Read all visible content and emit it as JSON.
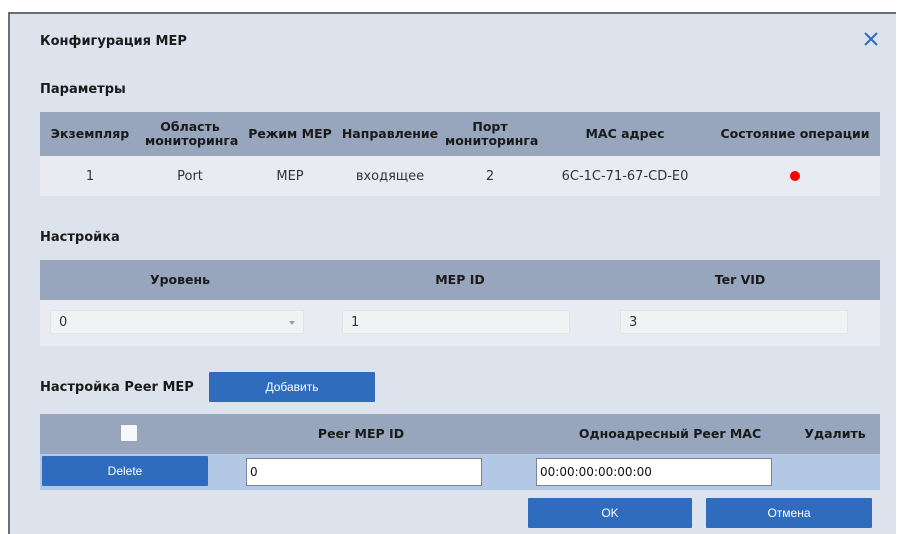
{
  "dialog": {
    "title": "Конфигурация MEP"
  },
  "parameters": {
    "label": "Параметры",
    "columns": [
      "Экземпляр",
      "Область мониторинга",
      "Режим MEP",
      "Направление",
      "Порт мониторинга",
      "MAC адрес",
      "Состояние операции"
    ],
    "row": {
      "instance": "1",
      "monitor_area": "Port",
      "mode": "MEP",
      "direction": "входящее",
      "monitor_port": "2",
      "mac": "6C-1C-71-67-CD-E0",
      "state_color": "#ff0000"
    }
  },
  "settings": {
    "label": "Настройка",
    "columns": [
      "Уровень",
      "MEP ID",
      "Ter VID"
    ],
    "level_value": "0",
    "mep_id_value": "1",
    "ter_vid_value": "3"
  },
  "peer_mep": {
    "label": "Настройка Peer MEP",
    "add_button": "Добавить",
    "columns": [
      "Peer MEP ID",
      "Одноадресный Peer MAC",
      "Удалить"
    ],
    "row": {
      "delete_button": "Delete",
      "peer_id": "0",
      "peer_mac": "00:00:00:00:00:00"
    }
  },
  "footer": {
    "ok": "OK",
    "cancel": "Отмена"
  },
  "colors": {
    "accent": "#2f6cbd",
    "header_bg": "#97a6bd",
    "dialog_bg": "#dde3ed"
  }
}
